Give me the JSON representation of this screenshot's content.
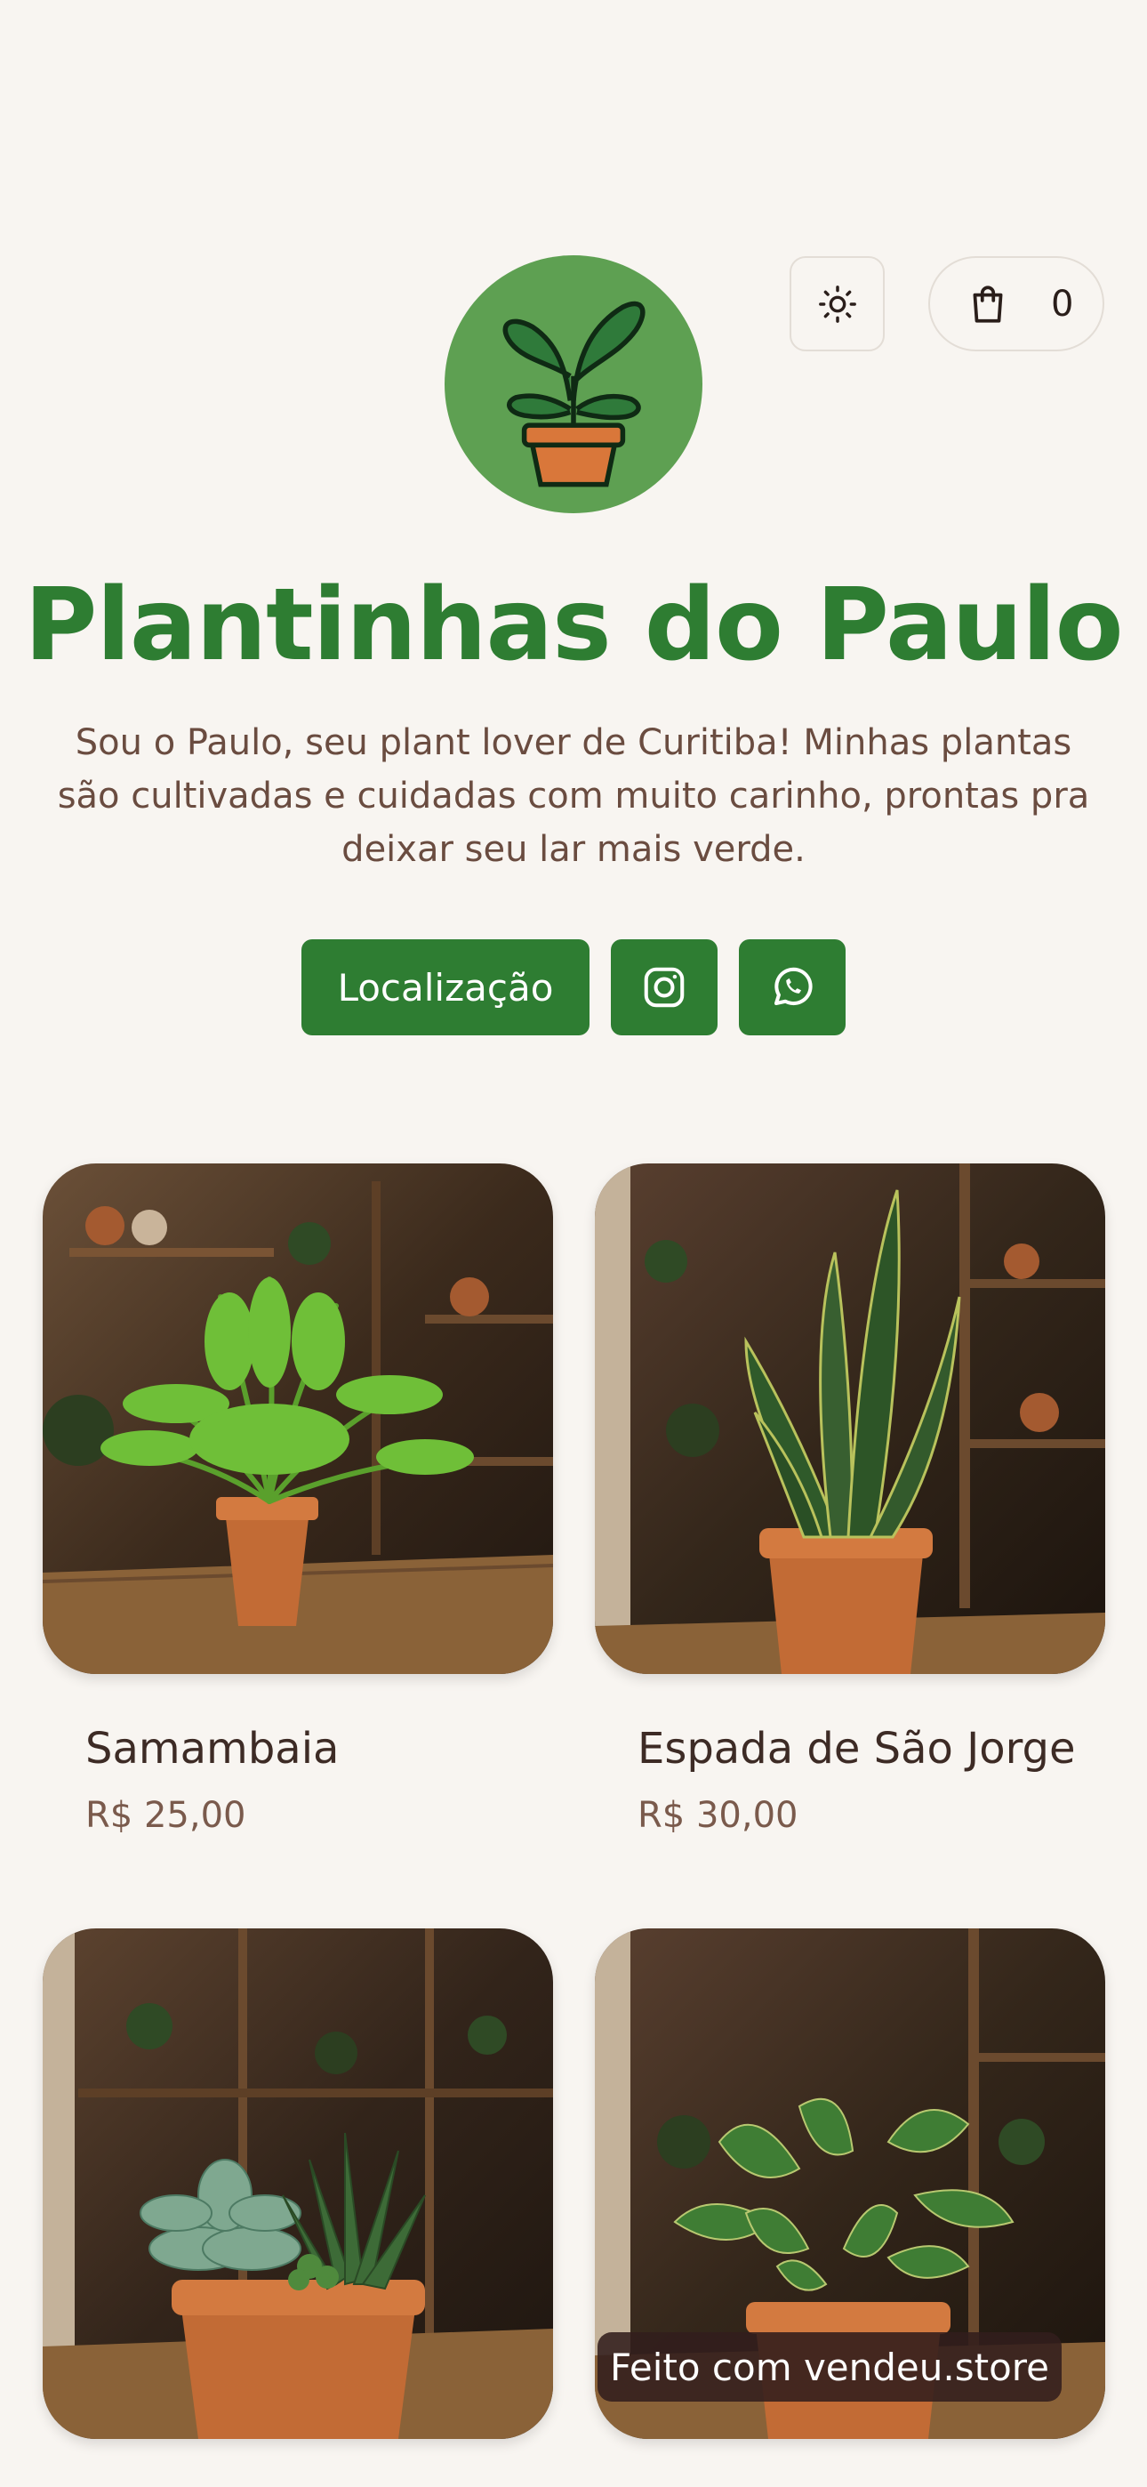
{
  "store": {
    "title": "Plantinhas do Paulo",
    "description": "Sou o Paulo, seu plant lover de Curitiba! Minhas plantas são cultivadas e cuidadas com muito carinho, prontas pra deixar seu lar mais verde."
  },
  "header": {
    "theme_icon": "sun-icon",
    "cart_icon": "shopping-bag-icon",
    "cart_count": "0"
  },
  "actions": {
    "location_label": "Localização",
    "instagram_icon": "instagram-icon",
    "whatsapp_icon": "whatsapp-icon"
  },
  "products": [
    {
      "name": "Samambaia",
      "price": "R$ 25,00"
    },
    {
      "name": "Espada de São Jorge",
      "price": "R$ 30,00"
    },
    {
      "name": "",
      "price": ""
    },
    {
      "name": "",
      "price": ""
    }
  ],
  "footer": {
    "badge": "Feito com vendeu.store"
  },
  "colors": {
    "accent": "#2e7d32",
    "background": "#f8f5f1",
    "logo_bg": "#5ea052"
  }
}
